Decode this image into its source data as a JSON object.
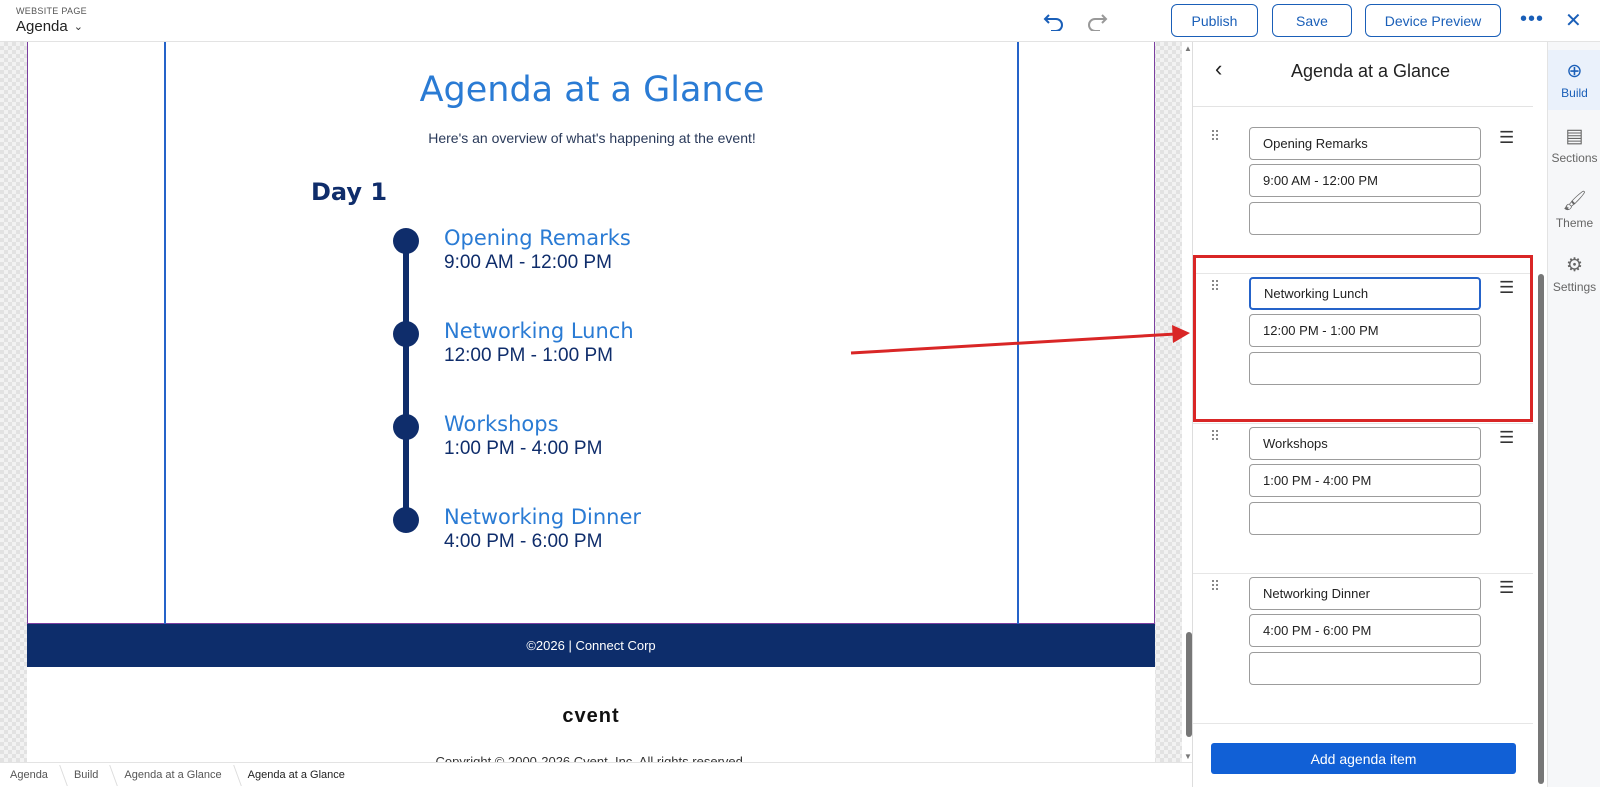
{
  "topbar": {
    "kicker": "WEBSITE PAGE",
    "page_name": "Agenda",
    "publish_label": "Publish",
    "save_label": "Save",
    "preview_label": "Device Preview"
  },
  "canvas": {
    "title": "Agenda at a Glance",
    "subtitle": "Here's an overview of what's happening at the event!",
    "day": "Day 1",
    "events": [
      {
        "name": "Opening Remarks",
        "time": "9:00 AM - 12:00 PM"
      },
      {
        "name": "Networking Lunch",
        "time": "12:00 PM - 1:00 PM"
      },
      {
        "name": "Workshops",
        "time": "1:00 PM - 4:00 PM"
      },
      {
        "name": "Networking Dinner",
        "time": "4:00 PM - 6:00 PM"
      }
    ],
    "footer": "©2026 | Connect Corp",
    "brand": "cvent",
    "copyright": "Copyright © 2000-2026 Cvent, Inc. All rights reserved."
  },
  "panel": {
    "title": "Agenda at a Glance",
    "items": [
      {
        "name": "Opening Remarks",
        "time": "9:00 AM - 12:00 PM",
        "extra": ""
      },
      {
        "name": "Networking Lunch",
        "time": "12:00 PM - 1:00 PM",
        "extra": ""
      },
      {
        "name": "Workshops",
        "time": "1:00 PM - 4:00 PM",
        "extra": ""
      },
      {
        "name": "Networking Dinner",
        "time": "4:00 PM - 6:00 PM",
        "extra": ""
      }
    ],
    "add_label": "Add agenda item"
  },
  "rail": {
    "items": [
      {
        "label": "Build",
        "icon": "plus-circle-icon"
      },
      {
        "label": "Sections",
        "icon": "sections-icon"
      },
      {
        "label": "Theme",
        "icon": "paint-brush-icon"
      },
      {
        "label": "Settings",
        "icon": "gear-icon"
      }
    ]
  },
  "breadcrumbs": [
    "Agenda",
    "Build",
    "Agenda at a Glance",
    "Agenda at a Glance"
  ],
  "colors": {
    "accent": "#1160d6",
    "navy": "#0f2d6b",
    "heading_blue": "#2a7bd4",
    "highlight_red": "#d92626"
  }
}
